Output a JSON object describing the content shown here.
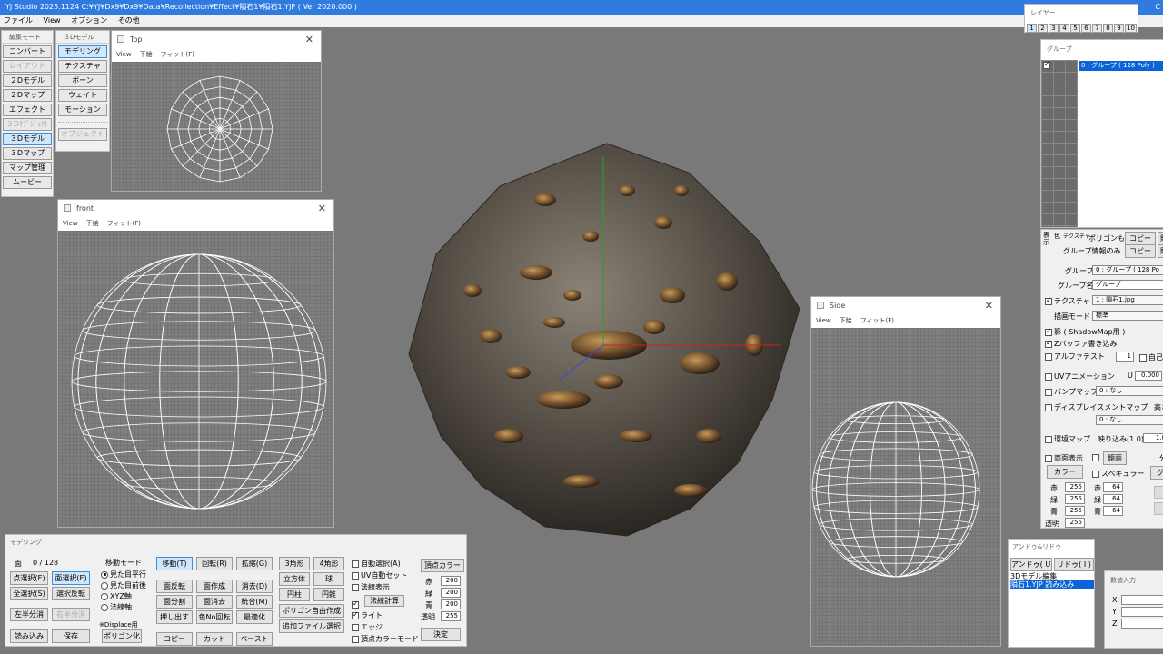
{
  "titlebar": {
    "title": "YJ Studio 2025.1124   C:¥YJ¥Dx9¥Dx9¥Data¥Recollection¥Effect¥隕石1¥隕石1.YJP ( Ver 2020.000 )",
    "right_glyph": "C"
  },
  "menu": [
    "ファイル",
    "View",
    "オプション",
    "その他"
  ],
  "edit_mode": {
    "header": "編集モード",
    "buttons": [
      {
        "label": "コンバート",
        "state": "normal"
      },
      {
        "label": "レイアウト",
        "state": "disabled"
      },
      {
        "label": "２Dモデル",
        "state": "normal"
      },
      {
        "label": "２Dマップ",
        "state": "normal"
      },
      {
        "label": "エフェクト",
        "state": "normal"
      },
      {
        "label": "３Dｵﾌﾞｼﾞｪｸﾄ",
        "state": "disabled"
      },
      {
        "label": "３Dモデル",
        "state": "selected"
      },
      {
        "label": "３Dマップ",
        "state": "normal"
      },
      {
        "label": "マップ管理",
        "state": "normal"
      },
      {
        "label": "ムービー",
        "state": "normal"
      }
    ]
  },
  "model3d": {
    "header": "３Dモデル",
    "buttons": [
      {
        "label": "モデリング",
        "state": "selected"
      },
      {
        "label": "テクスチャ",
        "state": "normal"
      },
      {
        "label": "ボーン",
        "state": "normal"
      },
      {
        "label": "ウェイト",
        "state": "normal"
      },
      {
        "label": "モーション",
        "state": "normal"
      },
      {
        "label": "オブジェクト",
        "state": "disabled"
      }
    ]
  },
  "views": {
    "top": {
      "title": "Top",
      "menu": [
        "View",
        "下絵",
        "フィット(F)"
      ]
    },
    "front": {
      "title": "front",
      "menu": [
        "View",
        "下絵",
        "フィット(F)"
      ]
    },
    "side": {
      "title": "Side",
      "menu": [
        "View",
        "下絵",
        "フィット(F)"
      ]
    },
    "close_glyph": "✕"
  },
  "layer": {
    "title": "レイヤー",
    "tabs": [
      "1",
      "2",
      "3",
      "4",
      "5",
      "6",
      "7",
      "8",
      "9",
      "10"
    ],
    "active": 0
  },
  "group": {
    "title": "グループ",
    "item": "0 : グループ ( 128 Poly )"
  },
  "props": {
    "tabs": [
      "表示",
      "色",
      "テクスチャ"
    ],
    "poly_only": "ポリゴンも",
    "group_info_only": "グループ情報のみ",
    "copy": "コピー",
    "paste_trunc": "貼",
    "group_label": "グループ",
    "group_value": "0 : グループ ( 128 Po",
    "group_name_label": "グループ名",
    "group_name_value": "グループ",
    "texture_label": "テクスチャ",
    "texture_value": "1 : 隕石1.jpg",
    "draw_mode_label": "描画モード",
    "draw_mode_value": "標準",
    "shadow": "影 ( ShadowMap用 )",
    "zbuffer": "Zバッファ書き込み",
    "alpha_test": "アルファテスト",
    "alpha_value": "1",
    "self_trunc": "自己発",
    "uv_anim": "UVアニメーション",
    "u_label": "U",
    "u_value": "0.000",
    "v_trunc": "V",
    "bump": "バンプマップ",
    "bump_value": "0 : なし",
    "displace": "ディスプレイスメントマップ",
    "height_trunc": "高さ",
    "displace_value": "0 : なし",
    "env": "環境マップ",
    "reflect": "映り込み(1.0)",
    "reflect_value": "1.0",
    "double_side": "両面表示",
    "mirror": "鏡面",
    "split_trunc": "分割",
    "color_btn": "カラー",
    "specular": "スペキュラー",
    "spec_trunc": "グ",
    "rgb_labels": [
      "赤",
      "緑",
      "青",
      "透明"
    ],
    "color_values": [
      "255",
      "255",
      "255",
      "255"
    ],
    "spec_values": [
      "64",
      "64",
      "64"
    ]
  },
  "undo": {
    "title": "アンドゥ&リドゥ",
    "undo": "アンドゥ( U )",
    "redo": "リドゥ( I )",
    "history": [
      "3Dモデル編集",
      "隕石1.YJP 読み込み"
    ]
  },
  "numeric": {
    "title": "数値入力",
    "axes": [
      "X",
      "Y",
      "Z"
    ]
  },
  "modeling": {
    "title": "モデリング",
    "face_label": "面",
    "face_count": "0 /  128",
    "select_buttons": [
      "点選択(E)",
      "面選択(E)",
      "全選択(S)",
      "選択反転",
      "左半分消",
      "右半分消"
    ],
    "load": "読み込み",
    "save": "保存",
    "move_mode": "移動モード",
    "move_options": [
      "見た目平行",
      "見た目前後",
      "XYZ軸",
      "法線軸"
    ],
    "displace_note": "※Displace用",
    "polygonize": "ポリゴン化",
    "ops": [
      "移動(T)",
      "回転(R)",
      "拡縮(G)",
      "面反転",
      "面作成",
      "消去(D)",
      "面分割",
      "面消去",
      "統合(M)",
      "押し出す",
      "色No回転",
      "最適化",
      "コピー",
      "カット",
      "ペースト"
    ],
    "shapes": [
      "3角形",
      "4角形",
      "立方体",
      "球",
      "円柱",
      "円錐"
    ],
    "poly_free": "ポリゴン自由作成",
    "add_file": "追加ファイル選択",
    "checks": [
      {
        "label": "自動選択(A)",
        "on": false
      },
      {
        "label": "UV自動セット",
        "on": false
      },
      {
        "label": "法線表示",
        "on": false
      },
      {
        "label": "法線計算",
        "on": true
      },
      {
        "label": "ライト",
        "on": true
      },
      {
        "label": "エッジ",
        "on": false
      },
      {
        "label": "頂点カラーモード",
        "on": false
      }
    ],
    "vcolor": "頂点カラー",
    "vcolor_labels": [
      "赤",
      "緑",
      "青",
      "透明"
    ],
    "vcolor_values": [
      "200",
      "200",
      "200",
      "255"
    ],
    "decide": "決定"
  },
  "colors": {
    "accent": "#2f7be0",
    "viewport": "#797979",
    "wire": "#ffffff",
    "selected": "#cfe6fb"
  }
}
